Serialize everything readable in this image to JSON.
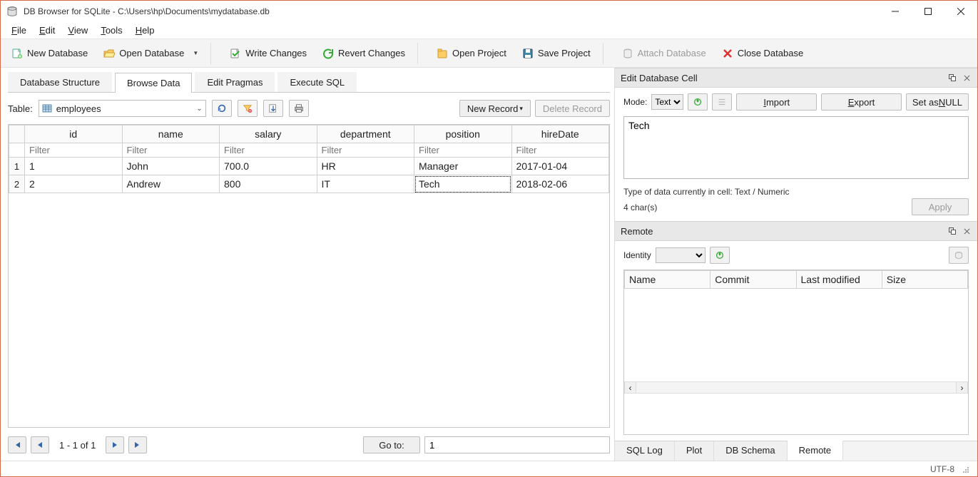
{
  "window": {
    "title": "DB Browser for SQLite - C:\\Users\\hp\\Documents\\mydatabase.db"
  },
  "menu": {
    "file": "File",
    "edit": "Edit",
    "view": "View",
    "tools": "Tools",
    "help": "Help"
  },
  "toolbar": {
    "new_db": "New Database",
    "open_db": "Open Database",
    "write_changes": "Write Changes",
    "revert_changes": "Revert Changes",
    "open_project": "Open Project",
    "save_project": "Save Project",
    "attach_db": "Attach Database",
    "close_db": "Close Database"
  },
  "tabs": {
    "structure": "Database Structure",
    "browse": "Browse Data",
    "pragmas": "Edit Pragmas",
    "execute": "Execute SQL"
  },
  "browse": {
    "table_label": "Table:",
    "table_selected": "employees",
    "new_record": "New Record",
    "delete_record": "Delete Record",
    "columns": [
      "id",
      "name",
      "salary",
      "department",
      "position",
      "hireDate"
    ],
    "filter_placeholder": "Filter",
    "rows": [
      {
        "n": "1",
        "id": "1",
        "name": "John",
        "salary": "700.0",
        "department": "HR",
        "position": "Manager",
        "hireDate": "2017-01-04"
      },
      {
        "n": "2",
        "id": "2",
        "name": "Andrew",
        "salary": "800",
        "department": "IT",
        "position": "Tech",
        "hireDate": "2018-02-06"
      }
    ],
    "selected_cell": {
      "row": 1,
      "col": "position"
    },
    "pager": "1 - 1 of 1",
    "goto_label": "Go to:",
    "goto_value": "1"
  },
  "editcell": {
    "title": "Edit Database Cell",
    "mode_label": "Mode:",
    "mode_value": "Text",
    "import": "Import",
    "export": "Export",
    "set_null": "Set as NULL",
    "value": "Tech",
    "type_line": "Type of data currently in cell: Text / Numeric",
    "chars_line": "4 char(s)",
    "apply": "Apply"
  },
  "remote": {
    "title": "Remote",
    "identity_label": "Identity",
    "columns": [
      "Name",
      "Commit",
      "Last modified",
      "Size"
    ]
  },
  "bottom_tabs": {
    "sql_log": "SQL Log",
    "plot": "Plot",
    "db_schema": "DB Schema",
    "remote": "Remote"
  },
  "status": {
    "encoding": "UTF-8"
  }
}
